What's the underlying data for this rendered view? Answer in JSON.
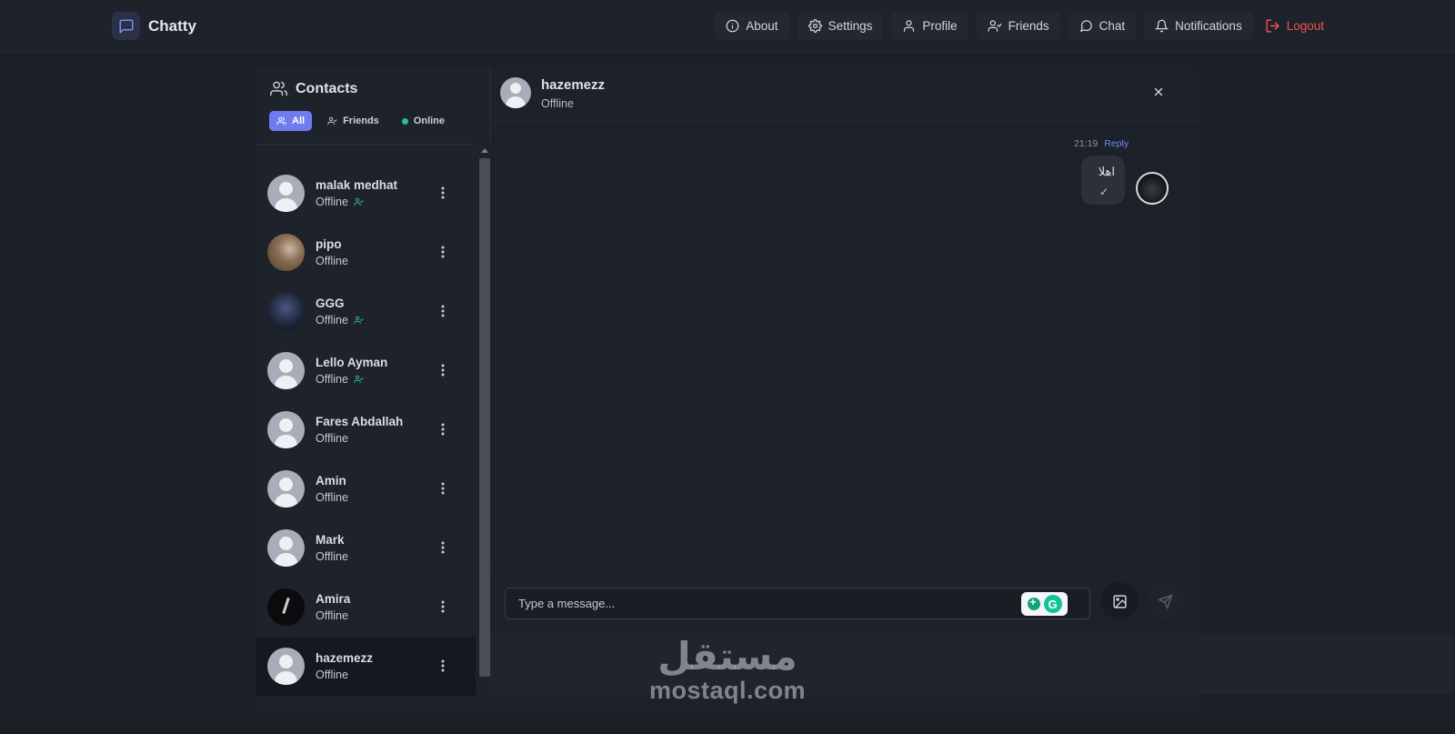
{
  "app": {
    "name": "Chatty"
  },
  "nav": {
    "about": "About",
    "settings": "Settings",
    "profile": "Profile",
    "friends": "Friends",
    "chat": "Chat",
    "notifications": "Notifications",
    "logout": "Logout"
  },
  "contacts": {
    "title": "Contacts",
    "filters": {
      "all": "All",
      "friends": "Friends",
      "online": "Online",
      "active": "All"
    },
    "items": [
      {
        "name": "malak medhat",
        "status": "Offline",
        "friend": true
      },
      {
        "name": "pipo",
        "status": "Offline",
        "friend": false
      },
      {
        "name": "GGG",
        "status": "Offline",
        "friend": true
      },
      {
        "name": "Lello Ayman",
        "status": "Offline",
        "friend": true
      },
      {
        "name": "Fares Abdallah",
        "status": "Offline",
        "friend": false
      },
      {
        "name": "Amin",
        "status": "Offline",
        "friend": false
      },
      {
        "name": "Mark",
        "status": "Offline",
        "friend": false
      },
      {
        "name": "Amira",
        "status": "Offline",
        "friend": false
      },
      {
        "name": "hazemezz",
        "status": "Offline",
        "friend": false,
        "selected": true
      }
    ]
  },
  "chat": {
    "peer": {
      "name": "hazemezz",
      "status": "Offline"
    },
    "messages": [
      {
        "text": "اهلا",
        "time": "21:19",
        "reply_label": "Reply",
        "read_mark": "✓"
      }
    ],
    "composer": {
      "placeholder": "Type a message..."
    }
  },
  "watermark": {
    "arabic": "مستقل",
    "latin": "mostaql.com"
  },
  "colors": {
    "accent": "#6f7cf0",
    "online": "#27c08a",
    "logout": "#ef5350",
    "reply": "#6f8cf0"
  },
  "icons": {
    "brand": "message-square-icon",
    "about": "info-icon",
    "settings": "gear-icon",
    "profile": "user-icon",
    "friends": "user-check-icon",
    "chat": "message-circle-icon",
    "notifications": "bell-icon",
    "logout": "logout-icon",
    "contacts": "users-icon",
    "more": "kebab-icon",
    "close": "close-icon",
    "image": "image-icon",
    "send": "send-icon"
  }
}
